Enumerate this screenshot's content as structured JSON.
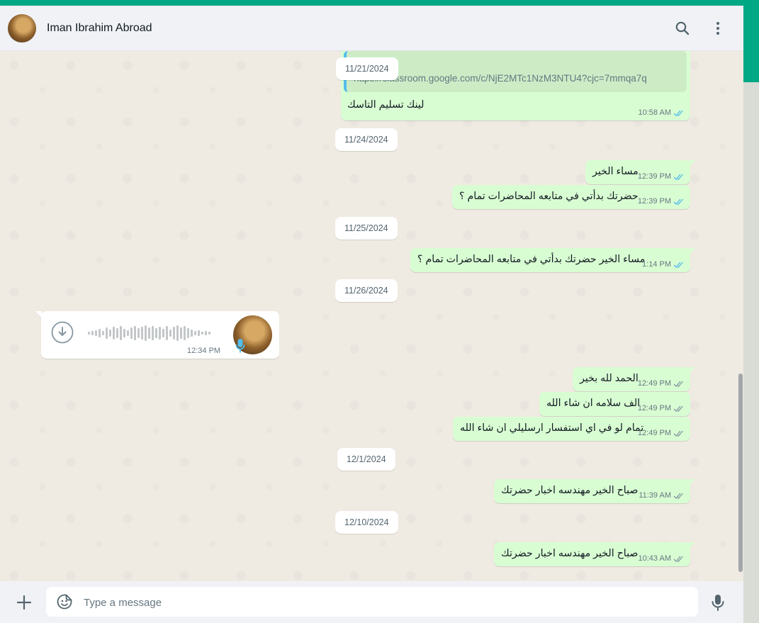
{
  "header": {
    "contact_name": "Iman Ibrahim Abroad",
    "icons": [
      "search-icon",
      "menu-icon"
    ]
  },
  "messages": {
    "link_preview_url": "https://classroom.google.com/c/NjE2MTc1NzM3NTU4?cjc=7mmqa7q",
    "dates": [
      "11/21/2024",
      "11/24/2024",
      "11/25/2024",
      "11/26/2024",
      "12/1/2024",
      "12/10/2024"
    ],
    "m1_text": "لينك تسليم التاسك",
    "m1_time": "10:58 AM",
    "m2_text": "مساء الخير",
    "m2_time": "12:39 PM",
    "m3_text": "حضرتك بدأتي في متابعه المحاضرات تمام ؟",
    "m3_time": "12:39 PM",
    "m4_text": "مساء الخير حضرتك بدأتي في متابعه المحاضرات تمام ؟",
    "m4_time": "1:14 PM",
    "voice_time": "12:34 PM",
    "m5_text": "الحمد لله بخير",
    "m5_time": "12:49 PM",
    "m6_text": "الف سلامه ان شاء الله",
    "m6_time": "12:49 PM",
    "m7_text": "تمام لو في اي استفسار ارسليلي ان شاء الله",
    "m7_time": "12:49 PM",
    "m8_text": "صباح الخير مهندسه اخبار حضرتك",
    "m8_time": "11:39 AM",
    "m9_text": "صباح الخير مهندسه اخبار حضرتك",
    "m9_time": "10:43 AM"
  },
  "footer": {
    "placeholder": "Type a message"
  },
  "colors": {
    "accent": "#00a884",
    "outgoing_bubble": "#d9fdd3",
    "read_ticks": "#53bdeb",
    "delivered_ticks": "#8696a0"
  }
}
